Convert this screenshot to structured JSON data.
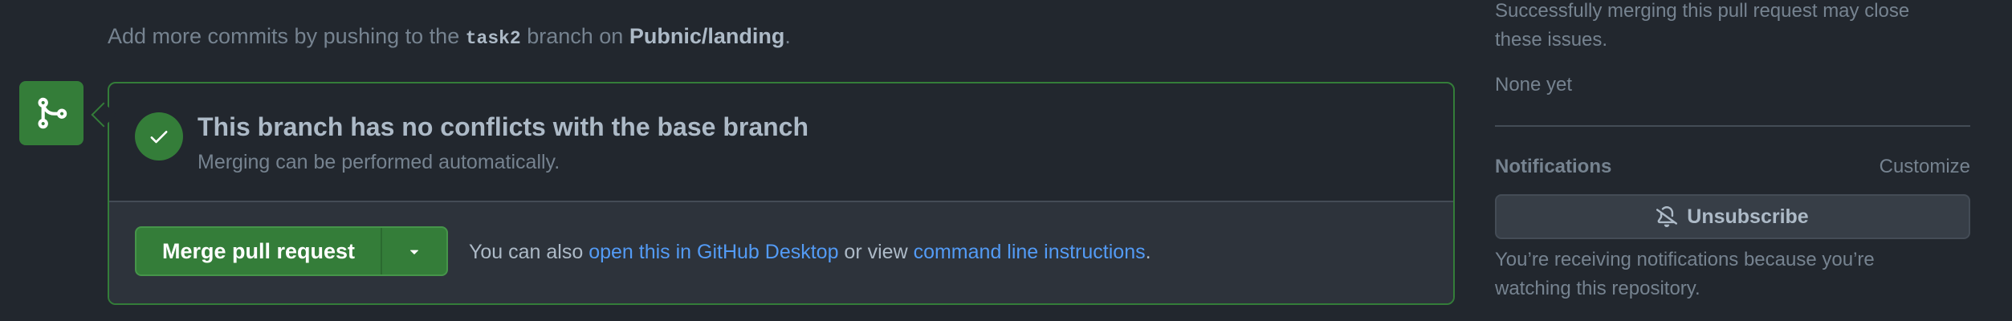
{
  "commit_hint": {
    "prefix": "Add more commits by pushing to the ",
    "branch": "task2",
    "middle": " branch on ",
    "repo": "Pubnic/landing",
    "suffix": "."
  },
  "merge_box": {
    "title": "This branch has no conflicts with the base branch",
    "subtitle": "Merging can be performed automatically.",
    "merge_button_label": "Merge pull request",
    "alt_prefix": "You can also ",
    "desktop_link": "open this in GitHub Desktop",
    "alt_middle": " or view ",
    "cli_link": "command line instructions",
    "alt_suffix": "."
  },
  "sidebar": {
    "issues_note": "Successfully merging this pull request may close these issues.",
    "issues_value": "None yet",
    "notifications_heading": "Notifications",
    "customize_label": "Customize",
    "unsubscribe_label": "Unsubscribe",
    "notification_reason": "You’re receiving notifications because you’re watching this repository."
  },
  "icons": {
    "merge_badge": "git-merge-icon",
    "check": "check-icon",
    "dropdown": "triangle-down-icon",
    "unsubscribe": "bell-slash-icon"
  },
  "colors": {
    "background": "#22272e",
    "success": "#347d39",
    "link": "#539bf5",
    "muted_text": "#768390",
    "default_text": "#adbac7"
  }
}
